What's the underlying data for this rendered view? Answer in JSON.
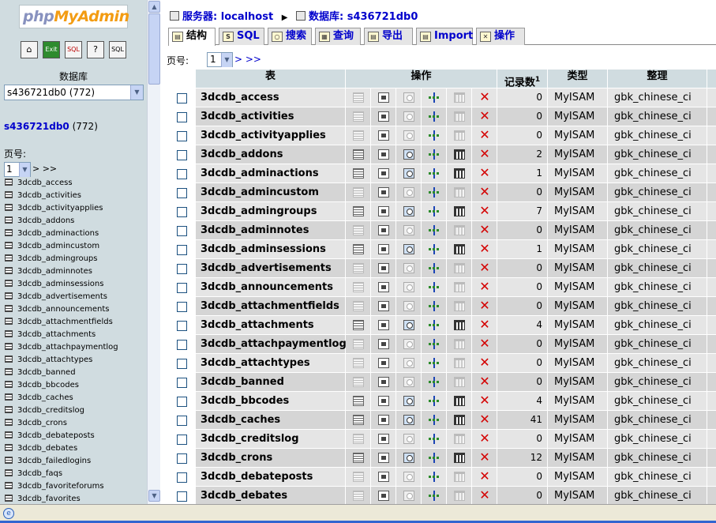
{
  "nav": {
    "logo": {
      "php": "php",
      "my": "My",
      "admin": "Admin"
    },
    "icons": [
      "home-icon",
      "exit-icon",
      "sql-icon",
      "help-icon",
      "sql-window-icon"
    ],
    "db_label": "数据库",
    "db_select_value": "s436721db0 (772)",
    "current_db_name": "s436721db0",
    "current_db_count": "(772)",
    "page_label": "页号:",
    "page_value": "1",
    "page_next": "> >>",
    "tables": [
      "3dcdb_access",
      "3dcdb_activities",
      "3dcdb_activityapplies",
      "3dcdb_addons",
      "3dcdb_adminactions",
      "3dcdb_admincustom",
      "3dcdb_admingroups",
      "3dcdb_adminnotes",
      "3dcdb_adminsessions",
      "3dcdb_advertisements",
      "3dcdb_announcements",
      "3dcdb_attachmentfields",
      "3dcdb_attachments",
      "3dcdb_attachpaymentlog",
      "3dcdb_attachtypes",
      "3dcdb_banned",
      "3dcdb_bbcodes",
      "3dcdb_caches",
      "3dcdb_creditslog",
      "3dcdb_crons",
      "3dcdb_debateposts",
      "3dcdb_debates",
      "3dcdb_failedlogins",
      "3dcdb_faqs",
      "3dcdb_favoriteforums",
      "3dcdb_favorites"
    ]
  },
  "breadcrumb": {
    "server_label": "服务器:",
    "server_value": "localhost",
    "db_label": "数据库:",
    "db_value": "s436721db0"
  },
  "tabs": [
    {
      "label": "结构",
      "icon": "structure-icon"
    },
    {
      "label": "SQL",
      "icon": "sql-icon"
    },
    {
      "label": "搜索",
      "icon": "search-icon"
    },
    {
      "label": "查询",
      "icon": "query-icon"
    },
    {
      "label": "导出",
      "icon": "export-icon"
    },
    {
      "label": "Import",
      "icon": "import-icon"
    },
    {
      "label": "操作",
      "icon": "operations-icon"
    }
  ],
  "pager": {
    "label": "页号:",
    "value": "1",
    "next": "> >>"
  },
  "table_headers": {
    "table": "表",
    "actions": "操作",
    "records": "记录数",
    "records_sup": "1",
    "type": "类型",
    "collation": "整理"
  },
  "rows": [
    {
      "name": "3dcdb_access",
      "records": "0",
      "type": "MyISAM",
      "collation": "gbk_chinese_ci"
    },
    {
      "name": "3dcdb_activities",
      "records": "0",
      "type": "MyISAM",
      "collation": "gbk_chinese_ci"
    },
    {
      "name": "3dcdb_activityapplies",
      "records": "0",
      "type": "MyISAM",
      "collation": "gbk_chinese_ci"
    },
    {
      "name": "3dcdb_addons",
      "records": "2",
      "type": "MyISAM",
      "collation": "gbk_chinese_ci"
    },
    {
      "name": "3dcdb_adminactions",
      "records": "1",
      "type": "MyISAM",
      "collation": "gbk_chinese_ci"
    },
    {
      "name": "3dcdb_admincustom",
      "records": "0",
      "type": "MyISAM",
      "collation": "gbk_chinese_ci"
    },
    {
      "name": "3dcdb_admingroups",
      "records": "7",
      "type": "MyISAM",
      "collation": "gbk_chinese_ci"
    },
    {
      "name": "3dcdb_adminnotes",
      "records": "0",
      "type": "MyISAM",
      "collation": "gbk_chinese_ci"
    },
    {
      "name": "3dcdb_adminsessions",
      "records": "1",
      "type": "MyISAM",
      "collation": "gbk_chinese_ci"
    },
    {
      "name": "3dcdb_advertisements",
      "records": "0",
      "type": "MyISAM",
      "collation": "gbk_chinese_ci"
    },
    {
      "name": "3dcdb_announcements",
      "records": "0",
      "type": "MyISAM",
      "collation": "gbk_chinese_ci"
    },
    {
      "name": "3dcdb_attachmentfields",
      "records": "0",
      "type": "MyISAM",
      "collation": "gbk_chinese_ci"
    },
    {
      "name": "3dcdb_attachments",
      "records": "4",
      "type": "MyISAM",
      "collation": "gbk_chinese_ci"
    },
    {
      "name": "3dcdb_attachpaymentlog",
      "records": "0",
      "type": "MyISAM",
      "collation": "gbk_chinese_ci"
    },
    {
      "name": "3dcdb_attachtypes",
      "records": "0",
      "type": "MyISAM",
      "collation": "gbk_chinese_ci"
    },
    {
      "name": "3dcdb_banned",
      "records": "0",
      "type": "MyISAM",
      "collation": "gbk_chinese_ci"
    },
    {
      "name": "3dcdb_bbcodes",
      "records": "4",
      "type": "MyISAM",
      "collation": "gbk_chinese_ci"
    },
    {
      "name": "3dcdb_caches",
      "records": "41",
      "type": "MyISAM",
      "collation": "gbk_chinese_ci"
    },
    {
      "name": "3dcdb_creditslog",
      "records": "0",
      "type": "MyISAM",
      "collation": "gbk_chinese_ci"
    },
    {
      "name": "3dcdb_crons",
      "records": "12",
      "type": "MyISAM",
      "collation": "gbk_chinese_ci"
    },
    {
      "name": "3dcdb_debateposts",
      "records": "0",
      "type": "MyISAM",
      "collation": "gbk_chinese_ci"
    },
    {
      "name": "3dcdb_debates",
      "records": "0",
      "type": "MyISAM",
      "collation": "gbk_chinese_ci"
    }
  ]
}
